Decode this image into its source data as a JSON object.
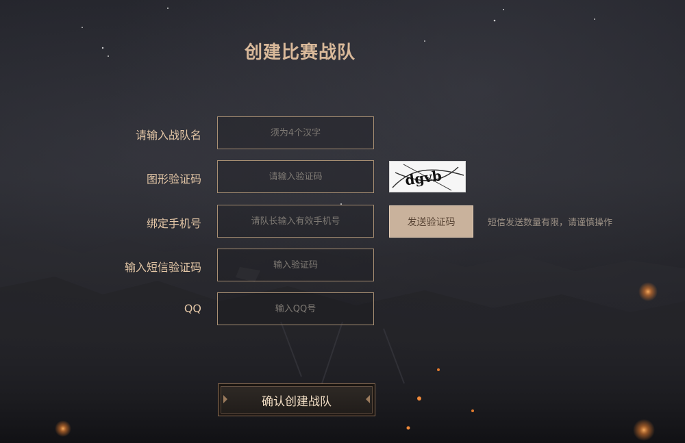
{
  "page": {
    "title": "创建比赛战队"
  },
  "form": {
    "team_name": {
      "label": "请输入战队名",
      "placeholder": "须为4个汉字"
    },
    "captcha": {
      "label": "图形验证码",
      "placeholder": "请输入验证码",
      "image_text": "dgvb"
    },
    "phone": {
      "label": "绑定手机号",
      "placeholder": "请队长输入有效手机号",
      "send_button": "发送验证码",
      "note": "短信发送数量有限，请谨慎操作"
    },
    "sms_code": {
      "label": "输入短信验证码",
      "placeholder": "输入验证码"
    },
    "qq": {
      "label": "QQ",
      "placeholder": "输入QQ号"
    },
    "submit": "确认创建战队"
  },
  "colors": {
    "accent": "#d9b99a",
    "label": "#e3c6a6",
    "field_border": "#a88f73",
    "send_button_bg": "#c9b29c",
    "ember": "#e07a2e"
  }
}
